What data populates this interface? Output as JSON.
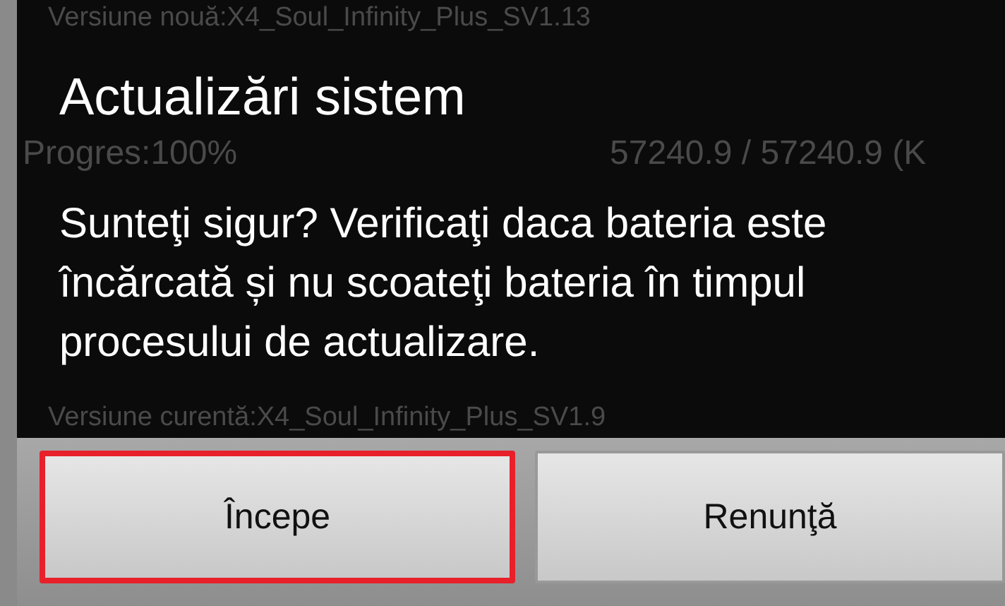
{
  "background": {
    "new_version": "Versiune nouă:X4_Soul_Infinity_Plus_SV1.13",
    "progress": "Progres:100%",
    "size": "57240.9 / 57240.9 (K",
    "current_version": "Versiune curentă:X4_Soul_Infinity_Plus_SV1.9"
  },
  "dialog": {
    "title": "Actualizări sistem",
    "message": "Sunteţi sigur? Verificaţi daca bateria este încărcată și nu scoateţi bateria în timpul procesului de actualizare."
  },
  "buttons": [
    {
      "label": "Începe",
      "selected": true
    },
    {
      "label": "Renunţă",
      "selected": false
    }
  ]
}
